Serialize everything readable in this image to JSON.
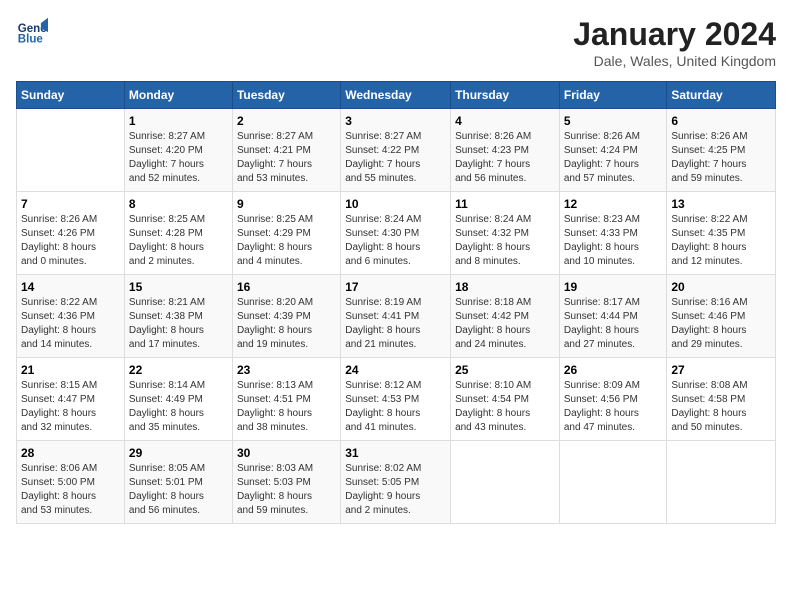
{
  "header": {
    "logo_line1": "General",
    "logo_line2": "Blue",
    "month_title": "January 2024",
    "location": "Dale, Wales, United Kingdom"
  },
  "weekdays": [
    "Sunday",
    "Monday",
    "Tuesday",
    "Wednesday",
    "Thursday",
    "Friday",
    "Saturday"
  ],
  "weeks": [
    [
      {
        "day": "",
        "detail": ""
      },
      {
        "day": "1",
        "detail": "Sunrise: 8:27 AM\nSunset: 4:20 PM\nDaylight: 7 hours\nand 52 minutes."
      },
      {
        "day": "2",
        "detail": "Sunrise: 8:27 AM\nSunset: 4:21 PM\nDaylight: 7 hours\nand 53 minutes."
      },
      {
        "day": "3",
        "detail": "Sunrise: 8:27 AM\nSunset: 4:22 PM\nDaylight: 7 hours\nand 55 minutes."
      },
      {
        "day": "4",
        "detail": "Sunrise: 8:26 AM\nSunset: 4:23 PM\nDaylight: 7 hours\nand 56 minutes."
      },
      {
        "day": "5",
        "detail": "Sunrise: 8:26 AM\nSunset: 4:24 PM\nDaylight: 7 hours\nand 57 minutes."
      },
      {
        "day": "6",
        "detail": "Sunrise: 8:26 AM\nSunset: 4:25 PM\nDaylight: 7 hours\nand 59 minutes."
      }
    ],
    [
      {
        "day": "7",
        "detail": "Sunrise: 8:26 AM\nSunset: 4:26 PM\nDaylight: 8 hours\nand 0 minutes."
      },
      {
        "day": "8",
        "detail": "Sunrise: 8:25 AM\nSunset: 4:28 PM\nDaylight: 8 hours\nand 2 minutes."
      },
      {
        "day": "9",
        "detail": "Sunrise: 8:25 AM\nSunset: 4:29 PM\nDaylight: 8 hours\nand 4 minutes."
      },
      {
        "day": "10",
        "detail": "Sunrise: 8:24 AM\nSunset: 4:30 PM\nDaylight: 8 hours\nand 6 minutes."
      },
      {
        "day": "11",
        "detail": "Sunrise: 8:24 AM\nSunset: 4:32 PM\nDaylight: 8 hours\nand 8 minutes."
      },
      {
        "day": "12",
        "detail": "Sunrise: 8:23 AM\nSunset: 4:33 PM\nDaylight: 8 hours\nand 10 minutes."
      },
      {
        "day": "13",
        "detail": "Sunrise: 8:22 AM\nSunset: 4:35 PM\nDaylight: 8 hours\nand 12 minutes."
      }
    ],
    [
      {
        "day": "14",
        "detail": "Sunrise: 8:22 AM\nSunset: 4:36 PM\nDaylight: 8 hours\nand 14 minutes."
      },
      {
        "day": "15",
        "detail": "Sunrise: 8:21 AM\nSunset: 4:38 PM\nDaylight: 8 hours\nand 17 minutes."
      },
      {
        "day": "16",
        "detail": "Sunrise: 8:20 AM\nSunset: 4:39 PM\nDaylight: 8 hours\nand 19 minutes."
      },
      {
        "day": "17",
        "detail": "Sunrise: 8:19 AM\nSunset: 4:41 PM\nDaylight: 8 hours\nand 21 minutes."
      },
      {
        "day": "18",
        "detail": "Sunrise: 8:18 AM\nSunset: 4:42 PM\nDaylight: 8 hours\nand 24 minutes."
      },
      {
        "day": "19",
        "detail": "Sunrise: 8:17 AM\nSunset: 4:44 PM\nDaylight: 8 hours\nand 27 minutes."
      },
      {
        "day": "20",
        "detail": "Sunrise: 8:16 AM\nSunset: 4:46 PM\nDaylight: 8 hours\nand 29 minutes."
      }
    ],
    [
      {
        "day": "21",
        "detail": "Sunrise: 8:15 AM\nSunset: 4:47 PM\nDaylight: 8 hours\nand 32 minutes."
      },
      {
        "day": "22",
        "detail": "Sunrise: 8:14 AM\nSunset: 4:49 PM\nDaylight: 8 hours\nand 35 minutes."
      },
      {
        "day": "23",
        "detail": "Sunrise: 8:13 AM\nSunset: 4:51 PM\nDaylight: 8 hours\nand 38 minutes."
      },
      {
        "day": "24",
        "detail": "Sunrise: 8:12 AM\nSunset: 4:53 PM\nDaylight: 8 hours\nand 41 minutes."
      },
      {
        "day": "25",
        "detail": "Sunrise: 8:10 AM\nSunset: 4:54 PM\nDaylight: 8 hours\nand 43 minutes."
      },
      {
        "day": "26",
        "detail": "Sunrise: 8:09 AM\nSunset: 4:56 PM\nDaylight: 8 hours\nand 47 minutes."
      },
      {
        "day": "27",
        "detail": "Sunrise: 8:08 AM\nSunset: 4:58 PM\nDaylight: 8 hours\nand 50 minutes."
      }
    ],
    [
      {
        "day": "28",
        "detail": "Sunrise: 8:06 AM\nSunset: 5:00 PM\nDaylight: 8 hours\nand 53 minutes."
      },
      {
        "day": "29",
        "detail": "Sunrise: 8:05 AM\nSunset: 5:01 PM\nDaylight: 8 hours\nand 56 minutes."
      },
      {
        "day": "30",
        "detail": "Sunrise: 8:03 AM\nSunset: 5:03 PM\nDaylight: 8 hours\nand 59 minutes."
      },
      {
        "day": "31",
        "detail": "Sunrise: 8:02 AM\nSunset: 5:05 PM\nDaylight: 9 hours\nand 2 minutes."
      },
      {
        "day": "",
        "detail": ""
      },
      {
        "day": "",
        "detail": ""
      },
      {
        "day": "",
        "detail": ""
      }
    ]
  ]
}
